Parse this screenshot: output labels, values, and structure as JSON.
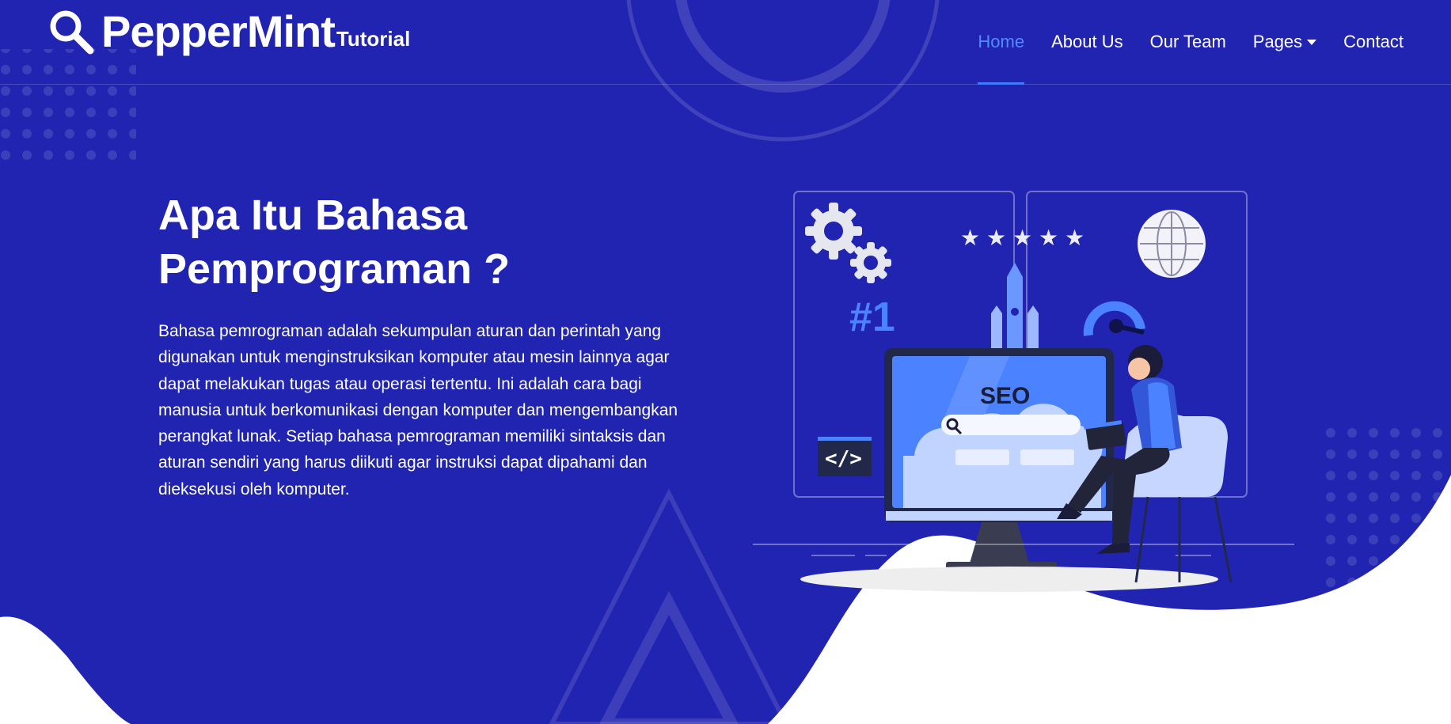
{
  "brand": {
    "name": "PepperMint",
    "suffix": "Tutorial",
    "icon": "search-icon"
  },
  "nav": {
    "items": [
      {
        "label": "Home",
        "active": true
      },
      {
        "label": "About Us"
      },
      {
        "label": "Our Team"
      },
      {
        "label": "Pages",
        "dropdown": true
      },
      {
        "label": "Contact"
      }
    ]
  },
  "hero": {
    "title_line1": "Apa Itu Bahasa",
    "title_line2": "Pemprograman ?",
    "description": "Bahasa pemrograman adalah sekumpulan aturan dan perintah yang digunakan untuk menginstruksikan komputer atau mesin lainnya agar dapat melakukan tugas atau operasi tertentu. Ini adalah cara bagi manusia untuk berkomunikasi dengan komputer dan mengembangkan perangkat lunak. Setiap bahasa pemrograman memiliki sintaksis dan aturan sendiri yang harus diikuti agar instruksi dapat dipahami dan dieksekusi oleh komputer."
  },
  "illustration": {
    "rank_label": "#1",
    "seo_label": "SEO",
    "code_label": "</>",
    "stars": 5
  },
  "colors": {
    "background": "#2124b1",
    "accent": "#3e7bff",
    "active_nav": "#4f8cff",
    "text": "#ffffff"
  }
}
